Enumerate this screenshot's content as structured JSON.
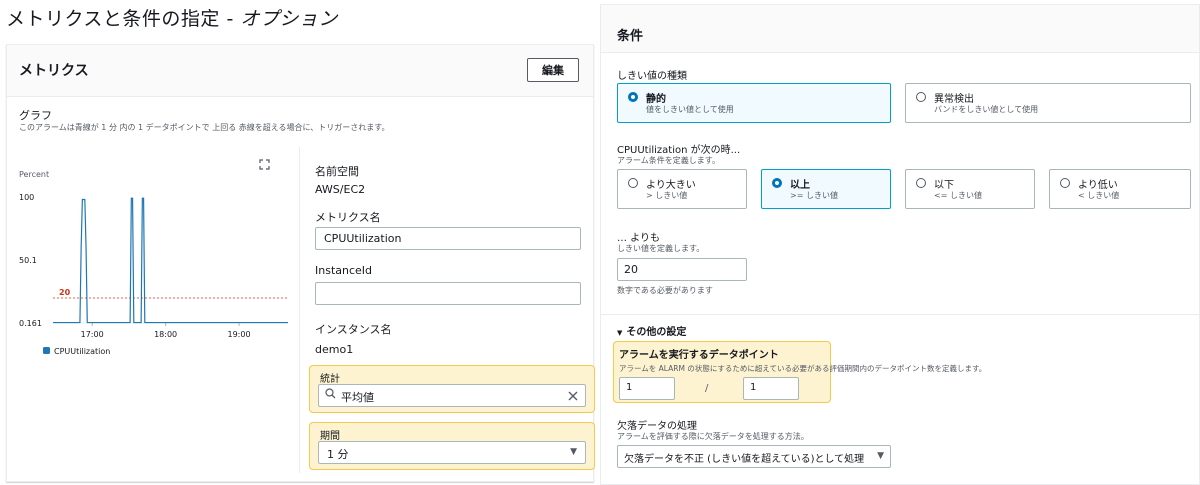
{
  "page": {
    "title_main": "メトリクスと条件の指定 - ",
    "title_optional": "オプション"
  },
  "metrics": {
    "header": "メトリクス",
    "edit_label": "編集",
    "graph_label": "グラフ",
    "graph_desc_prefix": "このアラームは",
    "graph_desc_blue": "青線",
    "graph_desc_mid": "が 1 分 内の 1 データポイントで 上回る ",
    "graph_desc_red": "赤線",
    "graph_desc_suffix": "を超える場合に、トリガーされます。",
    "namespace_label": "名前空間",
    "namespace_value": "AWS/EC2",
    "metric_name_label": "メトリクス名",
    "metric_name_value": "CPUUtilization",
    "instance_id_label": "InstanceId",
    "instance_id_value": "",
    "instance_name_label": "インスタンス名",
    "instance_name_value": "demo1",
    "statistic_label": "統計",
    "statistic_value": "平均値",
    "period_label": "期間",
    "period_value": "1 分"
  },
  "chart_data": {
    "type": "line",
    "ylabel": "Percent",
    "y_ticks": [
      "100",
      "50.1",
      "0.161"
    ],
    "x_ticks": [
      "17:00",
      "18:00",
      "19:00"
    ],
    "ylim": [
      0.161,
      100
    ],
    "threshold": 20,
    "threshold_label": "20",
    "series": [
      {
        "name": "CPUUtilization",
        "color": "#1f77b4",
        "x": [
          "16:28",
          "16:50",
          "16:51",
          "16:52",
          "16:53",
          "16:54",
          "16:55",
          "16:56",
          "16:57",
          "17:31",
          "17:32",
          "17:33",
          "17:34",
          "17:40",
          "17:41",
          "17:42",
          "17:43",
          "17:44",
          "19:40"
        ],
        "values": [
          0.5,
          0.5,
          60,
          98,
          98,
          98,
          60,
          0.5,
          0.5,
          0.5,
          99,
          99,
          0.5,
          0.5,
          99,
          99,
          0.5,
          0.5,
          0.5
        ]
      }
    ],
    "colors": {
      "line": "#1f77b4",
      "threshold": "#d13212",
      "grid": "#eaeded"
    }
  },
  "conditions": {
    "header": "条件",
    "threshold_type_label": "しきい値の種類",
    "static_title": "静的",
    "static_sub": "値をしきい値として使用",
    "anomaly_title": "異常検出",
    "anomaly_sub": "バンドをしきい値として使用",
    "when_label": "CPUUtilization が次の時...",
    "when_desc": "アラーム条件を定義します。",
    "options": [
      {
        "title": "より大きい",
        "sub": "> しきい値"
      },
      {
        "title": "以上",
        "sub": ">= しきい値"
      },
      {
        "title": "以下",
        "sub": "<= しきい値"
      },
      {
        "title": "より低い",
        "sub": "< しきい値"
      }
    ],
    "than_label": "… よりも",
    "than_desc": "しきい値を定義します。",
    "threshold_value": "20",
    "threshold_hint": "数字である必要があります",
    "other_settings": "その他の設定",
    "datapoints_title": "アラームを実行するデータポイント",
    "datapoints_desc": "アラームを ALARM の状態にするために超えている必要がある評価期間内のデータポイント数を定義します。",
    "datapoints_value": "1",
    "datapoints_of": "1",
    "datapoints_sep": "/",
    "missing_label": "欠落データの処理",
    "missing_desc": "アラームを評価する際に欠落データを処理する方法。",
    "missing_value": "欠落データを不正 (しきい値を超えている)として処理"
  },
  "icons": {
    "expand": "expand-icon",
    "search": "search-icon",
    "clear": "close-icon",
    "chevron": "chevron-down-icon",
    "triangle": "triangle-down-icon"
  }
}
